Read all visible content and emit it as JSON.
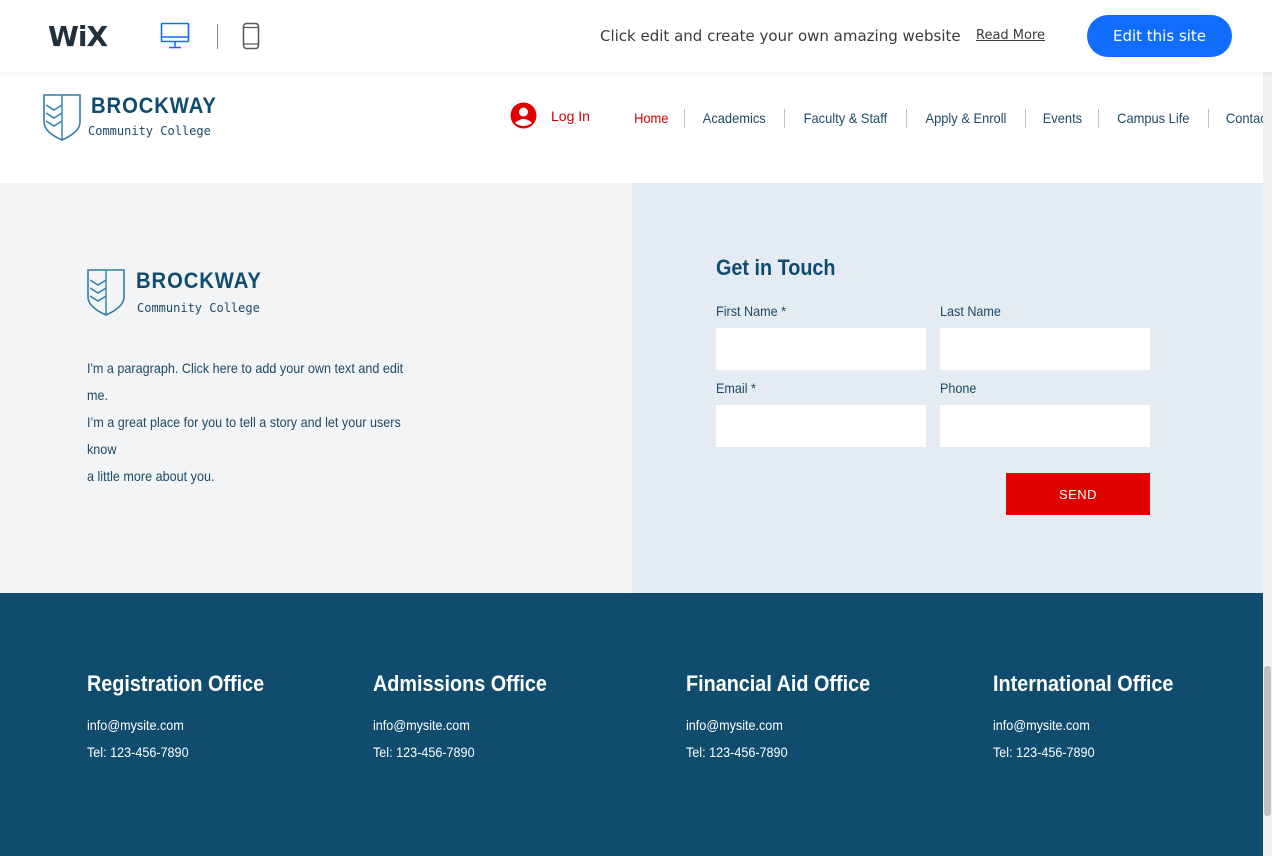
{
  "wix_bar": {
    "logo": "WiX",
    "tagline": "Click edit and create your own amazing website",
    "read_more": "Read More",
    "edit_button": "Edit this site",
    "accent_color": "#116dff"
  },
  "site": {
    "brand_name": "BROCKWAY",
    "brand_sub": "Community College",
    "login_label": "Log In",
    "nav": [
      {
        "label": "Home",
        "active": true
      },
      {
        "label": "Academics"
      },
      {
        "label": "Faculty & Staff"
      },
      {
        "label": "Apply & Enroll"
      },
      {
        "label": "Events"
      },
      {
        "label": "Campus Life"
      },
      {
        "label": "Contact"
      }
    ],
    "brand_color": "#0f4c6e",
    "accent_red": "#e00000"
  },
  "about": {
    "brand_name": "BROCKWAY",
    "brand_sub": "Community College",
    "paragraph_lines": [
      "I'm a paragraph. Click here to add your own text and edit me.",
      "I’m a great place for you to tell a story and let your users know",
      "a little more about you."
    ]
  },
  "contact_form": {
    "title": "Get in Touch",
    "first_name_label": "First Name",
    "last_name_label": "Last Name",
    "email_label": "Email",
    "phone_label": "Phone",
    "required_mark": "*",
    "first_name_value": "",
    "last_name_value": "",
    "email_value": "",
    "phone_value": "",
    "send_label": "SEND"
  },
  "footer": {
    "offices": [
      {
        "title": "Registration Office",
        "email": "info@mysite.com",
        "tel": "Tel: 123-456-7890"
      },
      {
        "title": "Admissions Office",
        "email": "info@mysite.com",
        "tel": "Tel: 123-456-7890"
      },
      {
        "title": "Financial Aid Office",
        "email": "info@mysite.com",
        "tel": "Tel: 123-456-7890"
      },
      {
        "title": "International Office",
        "email": "info@mysite.com",
        "tel": "Tel: 123-456-7890"
      }
    ]
  }
}
